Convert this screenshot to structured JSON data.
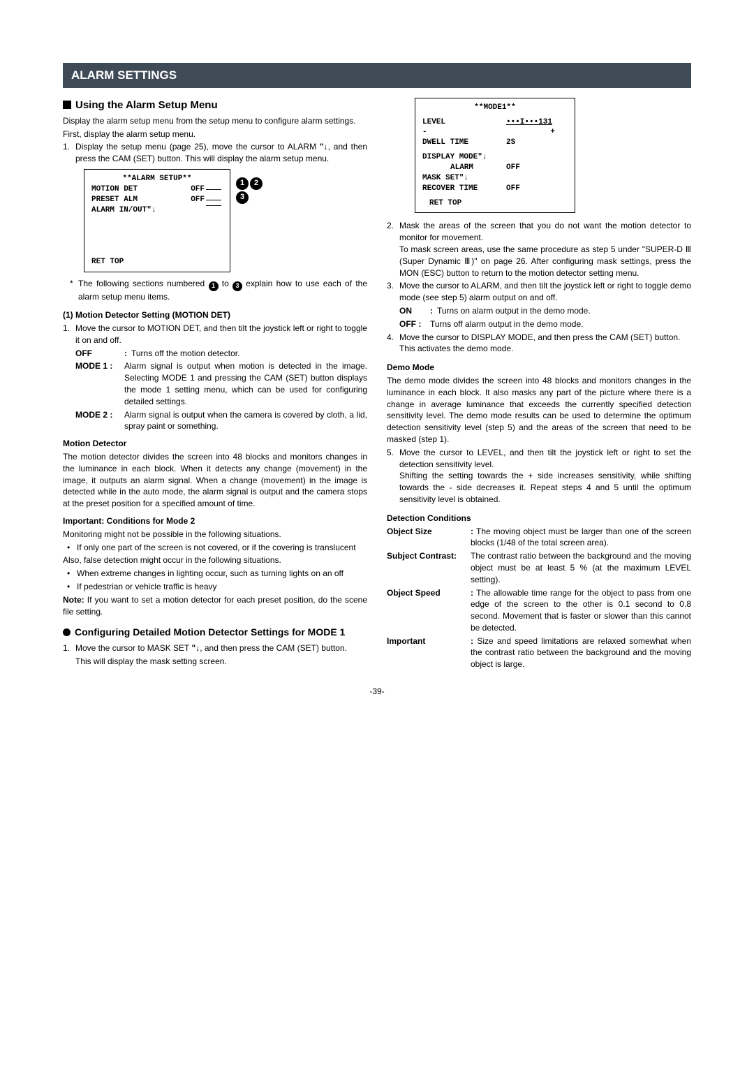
{
  "banner": "ALARM SETTINGS",
  "s1_title": "Using the Alarm Setup Menu",
  "s1_p1": "Display the alarm setup menu from the setup menu to configure alarm settings.",
  "s1_p2": "First, display the alarm setup menu.",
  "s1_step1a": "Display the setup menu (page 25), move the cursor to ALARM ",
  "s1_step1b": ", and then press the CAM (SET) button. This will display the alarm setup menu.",
  "screen1": {
    "title": "**ALARM SETUP**",
    "l1a": "MOTION DET",
    "l1b": "OFF",
    "l2a": "PRESET ALM",
    "l2b": "OFF",
    "l3": "ALARM IN/OUT\"↓",
    "ret": "RET TOP"
  },
  "badges": {
    "b1": "1",
    "b2": "2",
    "b3": "3"
  },
  "star_a": "The following sections numbered ",
  "star_b": " to ",
  "star_c": " explain how to use each of the alarm setup menu items.",
  "h_motion": "(1)  Motion Detector Setting (MOTION DET)",
  "motion_step1": "Move the cursor to MOTION DET, and then tilt the joystick left or right to toggle it on and off.",
  "opt_off": {
    "label": "OFF",
    "desc": "Turns off the motion detector."
  },
  "opt_m1": {
    "label": "MODE 1 :",
    "desc": "Alarm signal is output when motion is detected in the image. Selecting MODE 1 and pressing the CAM (SET) button displays the mode 1 setting menu, which can be used for configuring detailed settings."
  },
  "opt_m2": {
    "label": "MODE 2 :",
    "desc": "Alarm signal is output when the camera is covered by cloth, a lid, spray paint or something."
  },
  "h_md": "Motion Detector",
  "md_p": "The motion detector divides the screen into 48 blocks and monitors changes in the luminance in each block. When it detects any change (movement) in the image, it outputs an alarm signal. When a change (movement) in the image is detected while in the auto mode, the alarm signal is output and the camera stops at the preset position for a specified amount of time.",
  "h_cond2": "Important: Conditions for Mode 2",
  "cond2_p": "Monitoring might not be possible in the following situations.",
  "cond2_b1": "If only one part of the screen is not covered, or if the covering is translucent",
  "cond2_also": "Also, false detection might occur in the following situations.",
  "cond2_b2": "When extreme changes in lighting occur, such as turning lights on an off",
  "cond2_b3": "If pedestrian or vehicle traffic is heavy",
  "note_a": "Note:",
  "note_b": " If you want to set a motion detector for each preset position, do the scene file setting.",
  "s2_title": "Configuring Detailed Motion Detector Settings for MODE 1",
  "s2_step1a": "Move the cursor to MASK SET ",
  "s2_step1b": ", and then press the CAM (SET) button.",
  "s2_step1c": "This will display the mask setting screen.",
  "screen2": {
    "title": "**MODE1**",
    "l1a": "LEVEL",
    "l1b": "•••I•••131",
    "plus": "+",
    "minus": "-",
    "l2a": "DWELL TIME",
    "l2b": "2S",
    "l3": "DISPLAY MODE\"↓",
    "l4a": "ALARM",
    "l4b": "OFF",
    "l5": "MASK SET\"↓",
    "l6a": "RECOVER TIME",
    "l6b": "OFF",
    "ret": "RET TOP"
  },
  "r_step2a": "Mask the areas of the screen that you do not want the motion detector to monitor for movement.",
  "r_step2b": "To mask screen areas, use the same procedure as step 5 under \"SUPER-D Ⅲ (Super Dynamic Ⅲ)\" on page 26. After configuring mask settings, press the MON (ESC) button to return to the motion detector setting menu.",
  "r_step3": "Move the cursor to ALARM, and then tilt the joystick left or right to toggle demo mode (see step 5) alarm output on and off.",
  "r_on": {
    "label": "ON",
    "desc": "Turns on alarm output in the demo mode."
  },
  "r_off": {
    "label": "OFF :",
    "desc": "Turns off alarm output in the demo mode."
  },
  "r_step4a": "Move the cursor to DISPLAY MODE, and then press the CAM (SET) button.",
  "r_step4b": "This activates the demo mode.",
  "h_demo": "Demo Mode",
  "demo_p": "The demo mode divides the screen into 48 blocks and monitors changes in the luminance in each block. It also masks any part of the picture where there is a change in average luminance that exceeds the currently specified detection sensitivity level. The demo mode results can be used to determine the optimum detection sensitivity level (step 5) and the areas of the screen that need to be masked (step 1).",
  "r_step5a": "Move the cursor to LEVEL, and then tilt the joystick left or right to set the detection sensitivity level.",
  "r_step5b": "Shifting the setting towards the + side increases sensitivity, while shifting towards the - side decreases it. Repeat steps 4 and 5 until the optimum sensitivity level is obtained.",
  "h_dc": "Detection Conditions",
  "dc_os": {
    "label": "Object Size",
    "desc": "The moving object must be larger than one of the screen blocks (1/48 of the total screen area)."
  },
  "dc_sc": {
    "label": "Subject Contrast:",
    "desc": "The contrast ratio between the background and the moving object must be at least 5 % (at the maximum LEVEL setting)."
  },
  "dc_osp": {
    "label": "Object Speed",
    "desc": "The allowable time range for the object to pass from one edge of the screen to the other is 0.1 second to 0.8 second. Movement that is faster or slower than this cannot be detected."
  },
  "dc_imp": {
    "label": "Important",
    "desc": "Size and speed limitations are relaxed somewhat when the contrast ratio between the background and the moving object is large."
  },
  "pagenum": "-39-"
}
